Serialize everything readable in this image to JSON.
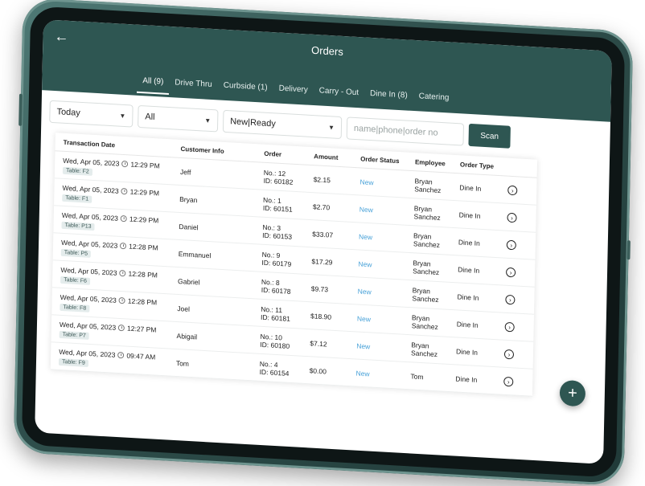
{
  "header": {
    "title": "Orders"
  },
  "tabs": [
    {
      "label": "All (9)"
    },
    {
      "label": "Drive Thru"
    },
    {
      "label": "Curbside (1)"
    },
    {
      "label": "Delivery"
    },
    {
      "label": "Carry - Out"
    },
    {
      "label": "Dine In (8)"
    },
    {
      "label": "Catering"
    }
  ],
  "filters": {
    "date": "Today",
    "type": "All",
    "status": "New|Ready",
    "search_placeholder": "name|phone|order no",
    "scan_label": "Scan"
  },
  "table": {
    "columns": [
      "Transaction Date",
      "Customer Info",
      "Order",
      "Amount",
      "Order Status",
      "Employee",
      "Order Type"
    ],
    "rows": [
      {
        "date": "Wed, Apr 05, 2023",
        "time": "12:29 PM",
        "table": "Table: F2",
        "customer": "Jeff",
        "order_no": "No.: 12",
        "order_id": "ID: 60182",
        "amount": "$2.15",
        "status": "New",
        "emp1": "Bryan",
        "emp2": "Sanchez",
        "order_type": "Dine In"
      },
      {
        "date": "Wed, Apr 05, 2023",
        "time": "12:29 PM",
        "table": "Table: F1",
        "customer": "Bryan",
        "order_no": "No.: 1",
        "order_id": "ID: 60151",
        "amount": "$2.70",
        "status": "New",
        "emp1": "Bryan",
        "emp2": "Sanchez",
        "order_type": "Dine In"
      },
      {
        "date": "Wed, Apr 05, 2023",
        "time": "12:29 PM",
        "table": "Table: P13",
        "customer": "Daniel",
        "order_no": "No.: 3",
        "order_id": "ID: 60153",
        "amount": "$33.07",
        "status": "New",
        "emp1": "Bryan",
        "emp2": "Sanchez",
        "order_type": "Dine In"
      },
      {
        "date": "Wed, Apr 05, 2023",
        "time": "12:28 PM",
        "table": "Table: P5",
        "customer": "Emmanuel",
        "order_no": "No.: 9",
        "order_id": "ID: 60179",
        "amount": "$17.29",
        "status": "New",
        "emp1": "Bryan",
        "emp2": "Sanchez",
        "order_type": "Dine In"
      },
      {
        "date": "Wed, Apr 05, 2023",
        "time": "12:28 PM",
        "table": "Table: F6",
        "customer": "Gabriel",
        "order_no": "No.: 8",
        "order_id": "ID: 60178",
        "amount": "$9.73",
        "status": "New",
        "emp1": "Bryan",
        "emp2": "Sanchez",
        "order_type": "Dine In"
      },
      {
        "date": "Wed, Apr 05, 2023",
        "time": "12:28 PM",
        "table": "Table: F8",
        "customer": "Joel",
        "order_no": "No.: 11",
        "order_id": "ID: 60181",
        "amount": "$18.90",
        "status": "New",
        "emp1": "Bryan",
        "emp2": "Sanchez",
        "order_type": "Dine In"
      },
      {
        "date": "Wed, Apr 05, 2023",
        "time": "12:27 PM",
        "table": "Table: P7",
        "customer": "Abigail",
        "order_no": "No.: 10",
        "order_id": "ID: 60180",
        "amount": "$7.12",
        "status": "New",
        "emp1": "Bryan",
        "emp2": "Sanchez",
        "order_type": "Dine In"
      },
      {
        "date": "Wed, Apr 05, 2023",
        "time": "09:47 AM",
        "table": "Table: F9",
        "customer": "Tom",
        "order_no": "No.: 4",
        "order_id": "ID: 60154",
        "amount": "$0.00",
        "status": "New",
        "emp1": "Tom",
        "emp2": "",
        "order_type": "Dine In"
      }
    ]
  },
  "icons": {
    "back": "arrow-left-icon",
    "clock": "clock-icon",
    "chevron": "chevron-right-circle-icon",
    "add": "plus-icon"
  },
  "colors": {
    "primary": "#2e5652",
    "status_new": "#4ba3d9"
  }
}
